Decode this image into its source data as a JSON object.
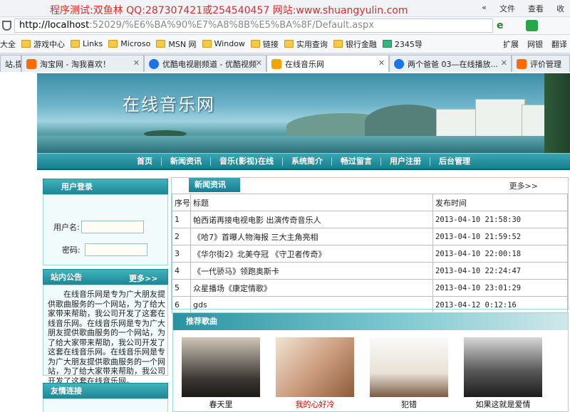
{
  "browser": {
    "watermark": "程序测试:双鱼林 QQ:287307421或254540457 网站:www.shuangyulin.com",
    "menu": [
      "文件",
      "查看",
      "收"
    ],
    "url_host": "http://localhost",
    "url_rest": ":52029/%E6%BA%90%E7%A8%8B%E5%BA%8F/Default.aspx",
    "bookmarks": [
      "大全",
      "游戏中心",
      "Links",
      "Microso",
      "MSN 网",
      "Window",
      "链接",
      "实用查询",
      "银行金融",
      "2345导"
    ],
    "extensions": [
      "扩展",
      "网银",
      "翻译"
    ],
    "tabs": [
      {
        "label": "站,提...",
        "color": "#e8e8e8"
      },
      {
        "label": "淘宝网 - 淘我喜欢！",
        "color": "#ff6a00"
      },
      {
        "label": "优酷电视剧频道 - 优酷视频",
        "color": "#1a73e8"
      },
      {
        "label": "在线音乐网",
        "color": "#f4a300"
      },
      {
        "label": "两个爸爸 03—在线播放...",
        "color": "#1a73e8"
      },
      {
        "label": "评价管理",
        "color": "#ff6a00"
      }
    ]
  },
  "site": {
    "title": "在线音乐网",
    "nav": [
      "首页",
      "新闻资讯",
      "音乐(影视)在线",
      "系统简介",
      "畅过留言",
      "用户注册",
      "后台管理"
    ]
  },
  "login": {
    "title": "用户登录",
    "username_label": "用户名:",
    "password_label": "密码:"
  },
  "notice": {
    "title": "站内公告",
    "more": "更多>>",
    "text": "在线音乐网是专为广大朋友提供歌曲服务的一个网站，为了给大家带来帮助，我公司开发了这套在线音乐网。在线音乐网是专为广大朋友提供歌曲服务的一个网站，为了给大家带来帮助，我公司开发了这套在线音乐网。在线音乐网是专为广大朋友提供歌曲服务的一个网站，为了给大家带来帮助，我公司开发了这套在线音乐网。"
  },
  "links": {
    "title": "友情连接"
  },
  "news": {
    "tab": "新闻资讯",
    "more": "更多>>",
    "headers": [
      "序号",
      "标题",
      "发布时间"
    ],
    "rows": [
      [
        "1",
        "帕西诺再接电视电影 出演传奇音乐人",
        "2013-04-10 21:58:30"
      ],
      [
        "2",
        "《哈7》首曝人物海报 三大主角亮相",
        "2013-04-10 21:59:52"
      ],
      [
        "3",
        "《华尔街2》北美夺冠 《守卫者传奇》",
        "2013-04-10 22:00:18"
      ],
      [
        "4",
        "《一代骄马》领跑奥斯卡",
        "2013-04-10 22:24:47"
      ],
      [
        "5",
        "众星播场《康定情歌》",
        "2013-04-10 23:01:29"
      ],
      [
        "6",
        "gds",
        "2013-04-12 0:12:16"
      ]
    ]
  },
  "songs": {
    "title": "推荐歌曲",
    "items": [
      {
        "name": "春天里",
        "highlight": false
      },
      {
        "name": "我的心好冷",
        "highlight": true
      },
      {
        "name": "犯错",
        "highlight": false
      },
      {
        "name": "如果这就是爱情",
        "highlight": false
      }
    ]
  }
}
